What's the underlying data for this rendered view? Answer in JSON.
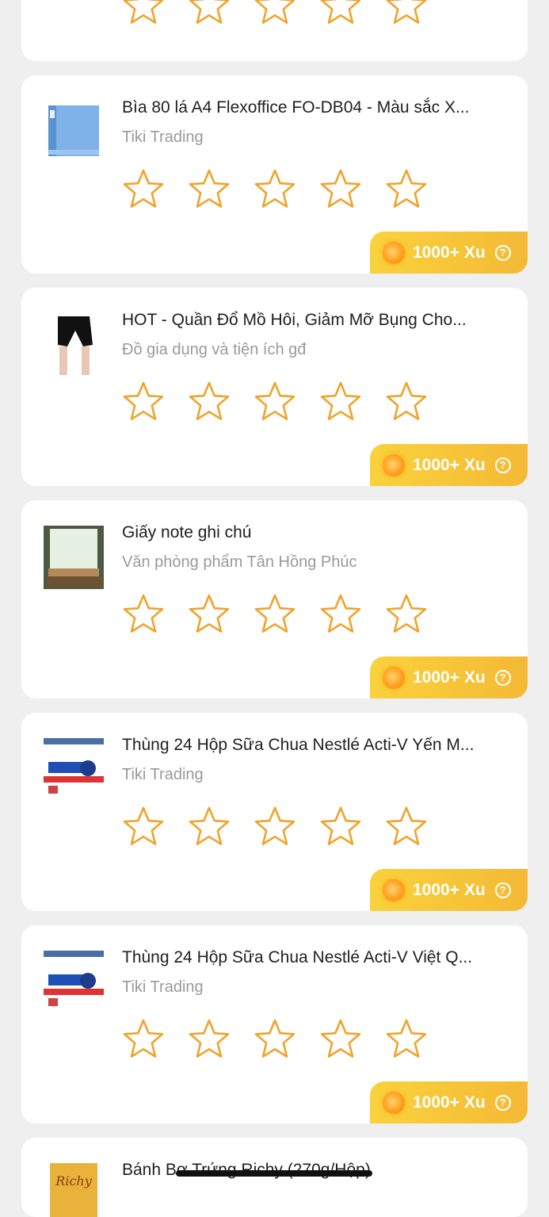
{
  "colors": {
    "star": "#f0a32b",
    "xu_gradient_start": "#f9d23c",
    "xu_gradient_end": "#f4b935"
  },
  "reward": {
    "label": "1000+ Xu",
    "help_icon": "?"
  },
  "top_partial": {
    "star_count": 5
  },
  "products": [
    {
      "title": "Bìa 80 lá A4 Flexoffice FO-DB04 - Màu sắc X...",
      "seller": "Tiki Trading",
      "thumb": "blue-binder"
    },
    {
      "title": "HOT - Quần Đổ Mồ Hôi, Giảm Mỡ Bụng Cho...",
      "seller": "Đồ gia dụng và tiện ích gđ",
      "thumb": "black-shorts"
    },
    {
      "title": "Giấy note ghi chú",
      "seller": "Văn phòng phẩm Tân Hồng Phúc",
      "thumb": "note-paper"
    },
    {
      "title": "Thùng 24 Hộp Sữa Chua Nestlé Acti-V Yến M...",
      "seller": "Tiki Trading",
      "thumb": "yogurt-box"
    },
    {
      "title": "Thùng 24 Hộp Sữa Chua Nestlé Acti-V Việt Q...",
      "seller": "Tiki Trading",
      "thumb": "yogurt-box"
    }
  ],
  "bottom_partial": {
    "title": "Bánh Bơ Trứng Richy (270g/Hộp)",
    "thumb": "richy-box"
  }
}
